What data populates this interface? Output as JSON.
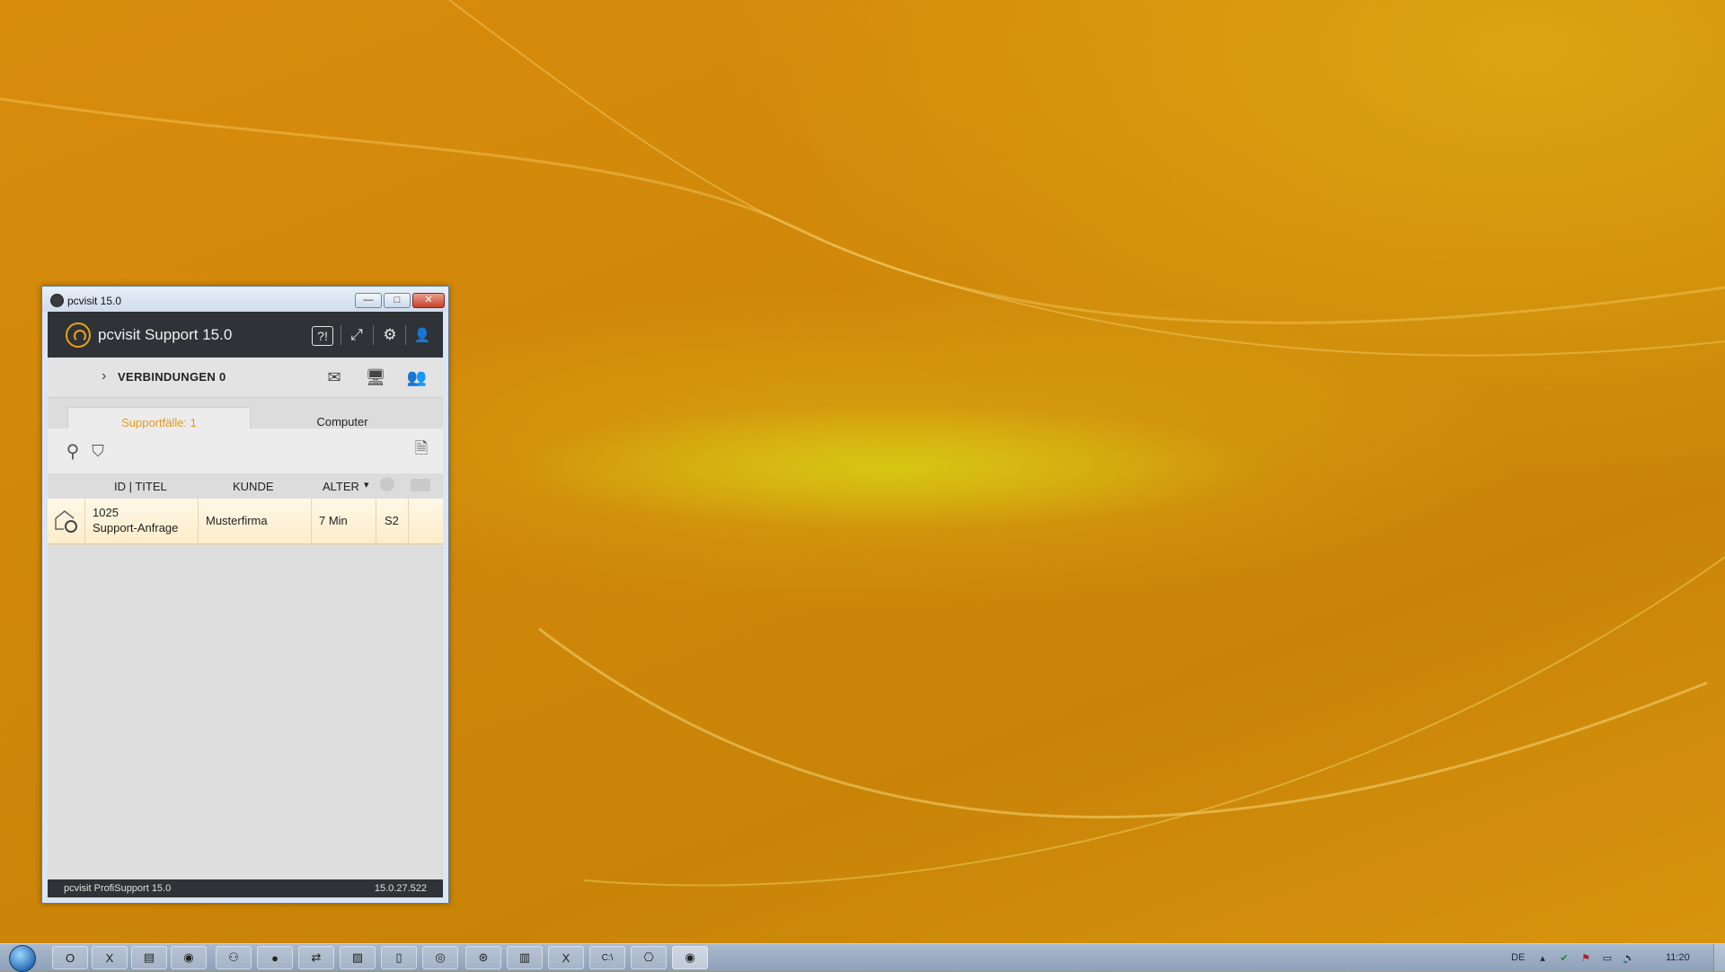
{
  "window": {
    "title": "pcvisit 15.0",
    "min_glyph": "—",
    "max_glyph": "□",
    "close_glyph": "✕"
  },
  "app": {
    "title": "pcvisit Support 15.0",
    "header_icons": [
      "help-icon",
      "fullscreen-icon",
      "settings-icon",
      "user-icon"
    ],
    "help_glyph": "?!",
    "fullscreen_glyph": "⤢",
    "settings_glyph": "⚙",
    "user_glyph": "👤"
  },
  "connections": {
    "chevron": "›",
    "label": "VERBINDUNGEN 0",
    "mail_glyph": "✉",
    "screen_glyph": "🖥",
    "contact_glyph": "👥"
  },
  "tabs": [
    {
      "label": "Supportfälle: 1",
      "active": true
    },
    {
      "label": "Computer",
      "active": false
    }
  ],
  "toolbar": {
    "search_glyph": "⚲",
    "filter_glyph": "⛉",
    "new_glyph": "🗎"
  },
  "table": {
    "columns": [
      "ID | TITEL",
      "KUNDE",
      "ALTER",
      "",
      ""
    ],
    "sort_glyph": "▾",
    "rows": [
      {
        "id": "1025",
        "title": "Support-Anfrage",
        "customer": "Musterfirma",
        "age": "7 Min",
        "assignee": "S2",
        "comment": ""
      }
    ]
  },
  "status": {
    "left": "pcvisit ProfiSupport 15.0",
    "right": "15.0.27.522"
  },
  "taskbar": {
    "items": [
      "O",
      "X",
      "▤",
      "◉",
      "⚇",
      "●",
      "⇄",
      "▨",
      "▯",
      "◎",
      "⊛",
      "▥",
      "X",
      "C:\\",
      "⎔",
      "◉"
    ],
    "tray": {
      "lang": "DE",
      "clock": "11:20"
    }
  },
  "colors": {
    "accent": "#e49a1b",
    "header": "#2f3236",
    "row_highlight": "#fdecc8"
  }
}
